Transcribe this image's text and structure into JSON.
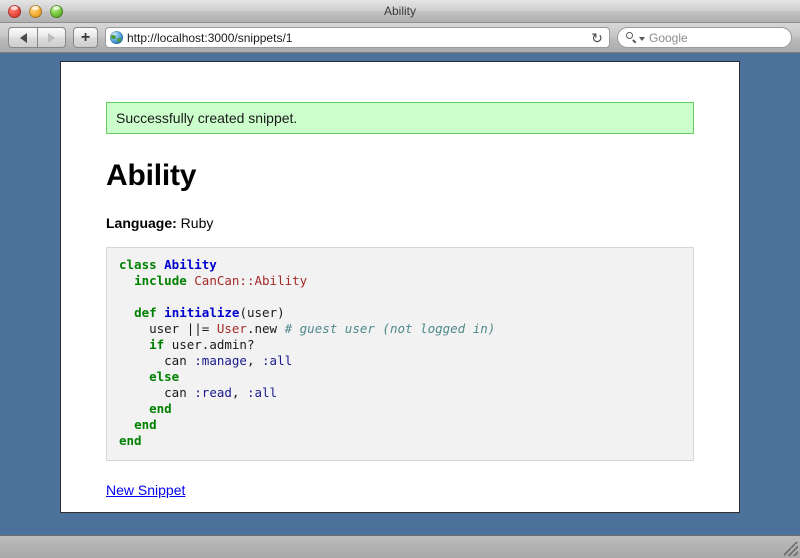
{
  "window": {
    "title": "Ability",
    "traffic_lights": [
      {
        "name": "close",
        "color": "#ef5347"
      },
      {
        "name": "minimize",
        "color": "#f5b33c"
      },
      {
        "name": "zoom",
        "color": "#78c840"
      }
    ]
  },
  "toolbar": {
    "back_label": "◀",
    "forward_label": "▶",
    "add_tab_label": "+",
    "url": "http://localhost:3000/snippets/1",
    "reload_label": "↻",
    "search_placeholder": "Google"
  },
  "page": {
    "flash_message": "Successfully created snippet.",
    "title": "Ability",
    "language_label": "Language:",
    "language_value": "Ruby",
    "new_snippet_link": "New Snippet",
    "code": {
      "language": "Ruby",
      "lines": [
        [
          {
            "t": "class ",
            "c": "k"
          },
          {
            "t": "Ability",
            "c": "cn"
          }
        ],
        [
          {
            "t": "  ",
            "c": "pl"
          },
          {
            "t": "include",
            "c": "k"
          },
          {
            "t": " ",
            "c": "pl"
          },
          {
            "t": "CanCan::Ability",
            "c": "co"
          }
        ],
        [],
        [
          {
            "t": "  ",
            "c": "pl"
          },
          {
            "t": "def",
            "c": "k"
          },
          {
            "t": " ",
            "c": "pl"
          },
          {
            "t": "initialize",
            "c": "fn"
          },
          {
            "t": "(user)",
            "c": "pl"
          }
        ],
        [
          {
            "t": "    user ||= ",
            "c": "pl"
          },
          {
            "t": "User",
            "c": "co"
          },
          {
            "t": ".new ",
            "c": "pl"
          },
          {
            "t": "# guest user (not logged in)",
            "c": "cm"
          }
        ],
        [
          {
            "t": "    ",
            "c": "pl"
          },
          {
            "t": "if",
            "c": "k"
          },
          {
            "t": " user.admin?",
            "c": "pl"
          }
        ],
        [
          {
            "t": "      can ",
            "c": "pl"
          },
          {
            "t": ":manage",
            "c": "sy"
          },
          {
            "t": ", ",
            "c": "pl"
          },
          {
            "t": ":all",
            "c": "sy"
          }
        ],
        [
          {
            "t": "    ",
            "c": "pl"
          },
          {
            "t": "else",
            "c": "k"
          }
        ],
        [
          {
            "t": "      can ",
            "c": "pl"
          },
          {
            "t": ":read",
            "c": "sy"
          },
          {
            "t": ", ",
            "c": "pl"
          },
          {
            "t": ":all",
            "c": "sy"
          }
        ],
        [
          {
            "t": "    ",
            "c": "pl"
          },
          {
            "t": "end",
            "c": "k"
          }
        ],
        [
          {
            "t": "  ",
            "c": "pl"
          },
          {
            "t": "end",
            "c": "k"
          }
        ],
        [
          {
            "t": "end",
            "c": "k"
          }
        ]
      ]
    }
  }
}
